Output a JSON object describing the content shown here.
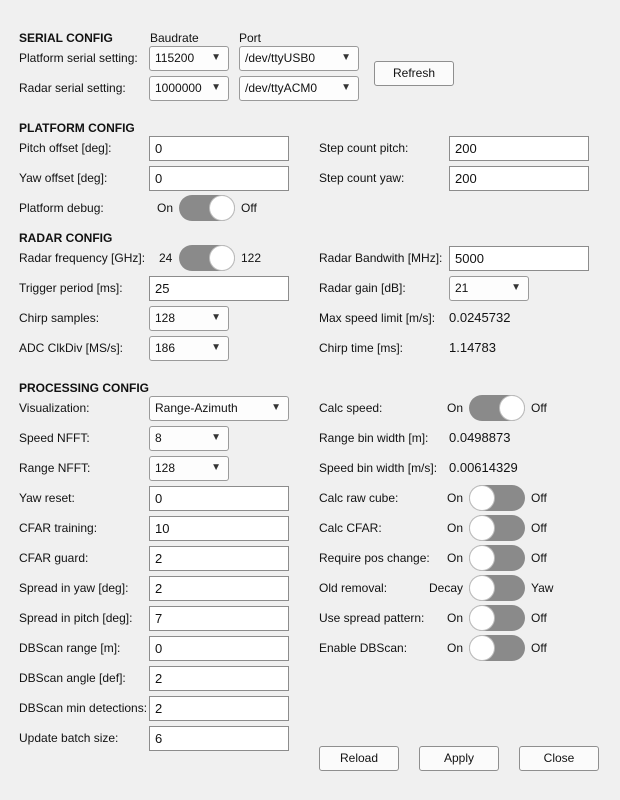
{
  "serial": {
    "title": "SERIAL CONFIG",
    "col_baud": "Baudrate",
    "col_port": "Port",
    "platform_label": "Platform serial setting:",
    "platform_baud": "115200",
    "platform_port": "/dev/ttyUSB0",
    "radar_label": "Radar serial setting:",
    "radar_baud": "1000000",
    "radar_port": "/dev/ttyACM0",
    "refresh": "Refresh"
  },
  "platform": {
    "title": "PLATFORM CONFIG",
    "pitch_offset_label": "Pitch offset [deg]:",
    "pitch_offset": "0",
    "yaw_offset_label": "Yaw offset [deg]:",
    "yaw_offset": "0",
    "debug_label": "Platform debug:",
    "debug_on": "On",
    "debug_off": "Off",
    "step_pitch_label": "Step count pitch:",
    "step_pitch": "200",
    "step_yaw_label": "Step count yaw:",
    "step_yaw": "200"
  },
  "radar": {
    "title": "RADAR CONFIG",
    "freq_label": "Radar frequency [GHz]:",
    "freq_a": "24",
    "freq_b": "122",
    "trigger_label": "Trigger period [ms]:",
    "trigger": "25",
    "chirp_samples_label": "Chirp samples:",
    "chirp_samples": "128",
    "adc_label": "ADC ClkDiv [MS/s]:",
    "adc": "186",
    "bandwidth_label": "Radar Bandwith [MHz]:",
    "bandwidth": "5000",
    "gain_label": "Radar gain [dB]:",
    "gain": "21",
    "max_speed_label": "Max speed limit [m/s]:",
    "max_speed": "0.0245732",
    "chirp_time_label": "Chirp time [ms]:",
    "chirp_time": "1.14783"
  },
  "processing": {
    "title": "PROCESSING CONFIG",
    "visualization_label": "Visualization:",
    "visualization": "Range-Azimuth",
    "speed_nfft_label": "Speed NFFT:",
    "speed_nfft": "8",
    "range_nfft_label": "Range NFFT:",
    "range_nfft": "128",
    "yaw_reset_label": "Yaw reset:",
    "yaw_reset": "0",
    "cfar_training_label": "CFAR training:",
    "cfar_training": "10",
    "cfar_guard_label": "CFAR guard:",
    "cfar_guard": "2",
    "spread_yaw_label": "Spread in yaw [deg]:",
    "spread_yaw": "2",
    "spread_pitch_label": "Spread in pitch [deg]:",
    "spread_pitch": "7",
    "dbscan_range_label": "DBScan range [m]:",
    "dbscan_range": "0",
    "dbscan_angle_label": "DBScan angle [def]:",
    "dbscan_angle": "2",
    "dbscan_min_label": "DBScan min detections:",
    "dbscan_min": "2",
    "batch_label": "Update batch size:",
    "batch": "6",
    "calc_speed_label": "Calc speed:",
    "range_bin_label": "Range bin width [m]:",
    "range_bin": "0.0498873",
    "speed_bin_label": "Speed bin width [m/s]:",
    "speed_bin": "0.00614329",
    "calc_raw_label": "Calc raw cube:",
    "calc_cfar_label": "Calc CFAR:",
    "pos_change_label": "Require pos change:",
    "old_removal_label": "Old removal:",
    "old_removal_a": "Decay",
    "old_removal_b": "Yaw",
    "spread_pattern_label": "Use spread pattern:",
    "dbscan_enable_label": "Enable DBScan:",
    "on": "On",
    "off": "Off"
  },
  "buttons": {
    "reload": "Reload",
    "apply": "Apply",
    "close": "Close"
  },
  "icons": {
    "dropdown": "chevron-down-icon"
  }
}
